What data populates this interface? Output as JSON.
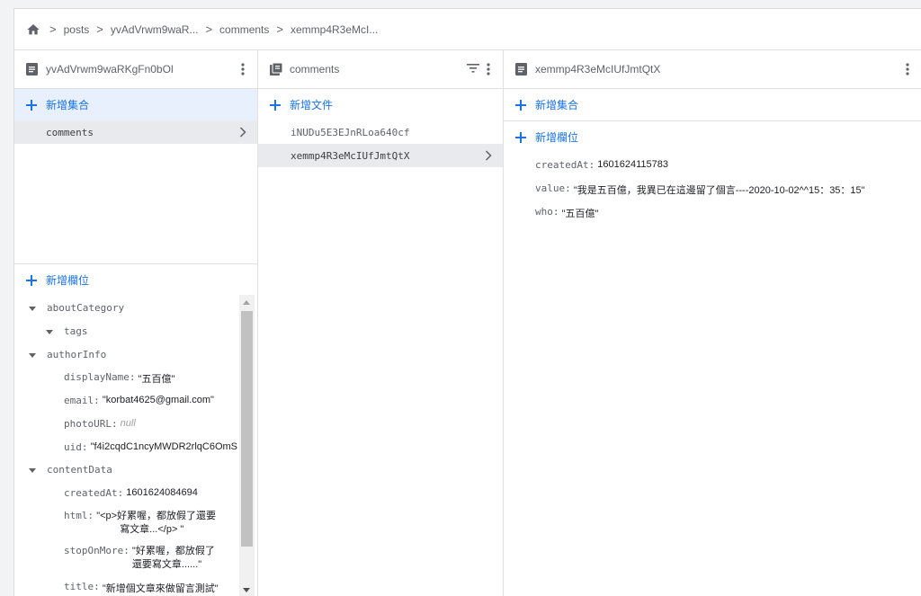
{
  "breadcrumb": {
    "segments": [
      "posts",
      "yvAdVrwm9waR...",
      "comments",
      "xemmp4R3eMcI..."
    ],
    "separator": ">"
  },
  "col1": {
    "title": "yvAdVrwm9waRKgFn0bOl",
    "add_collection": "新增集合",
    "collections": [
      "comments"
    ],
    "add_field": "新增欄位",
    "fields": {
      "aboutCategory": "aboutCategory",
      "tags": "tags",
      "authorInfo": "authorInfo",
      "displayName_key": "displayName:",
      "displayName_val": "\"五百億\"",
      "email_key": "email:",
      "email_val": "\"korbat4625@gmail.com\"",
      "photoURL_key": "photoURL:",
      "photoURL_val": "null",
      "uid_key": "uid:",
      "uid_val": "\"f4i2cqdC1ncyMWDR2rlqC6OmS",
      "contentData": "contentData",
      "createdAt_key": "createdAt:",
      "createdAt_val": "1601624084694",
      "html_key": "html:",
      "html_val1": "\"<p>好累喔，都放假了還要",
      "html_val2": "寫文章...</p> \"",
      "stopOnMore_key": "stopOnMore:",
      "stopOnMore_val1": "\"好累喔，都放假了",
      "stopOnMore_val2": "還要寫文章......\"",
      "title_key": "title:",
      "title_val": "\"新增個文章來做留言測試\""
    }
  },
  "col2": {
    "title": "comments",
    "add_document": "新增文件",
    "documents": [
      "iNUDu5E3EJnRLoa640cf",
      "xemmp4R3eMcIUfJmtQtX"
    ]
  },
  "col3": {
    "title": "xemmp4R3eMcIUfJmtQtX",
    "add_collection": "新增集合",
    "add_field": "新增欄位",
    "fields": {
      "createdAt_key": "createdAt:",
      "createdAt_val": "1601624115783",
      "value_key": "value:",
      "value_val": "\"我是五百億，我異已在這邊留了個言----2020-10-02^^15：35：15\"",
      "who_key": "who:",
      "who_val": "\"五百億\""
    }
  },
  "colors": {
    "accent": "#1a73e8",
    "selected_bg": "#e8eaed",
    "highlight_bg": "#e8f0fe"
  },
  "icons": [
    "home-icon",
    "document-icon",
    "collection-icon",
    "more-vert-icon",
    "filter-icon",
    "plus-icon",
    "chevron-right-icon",
    "caret-down-icon"
  ]
}
